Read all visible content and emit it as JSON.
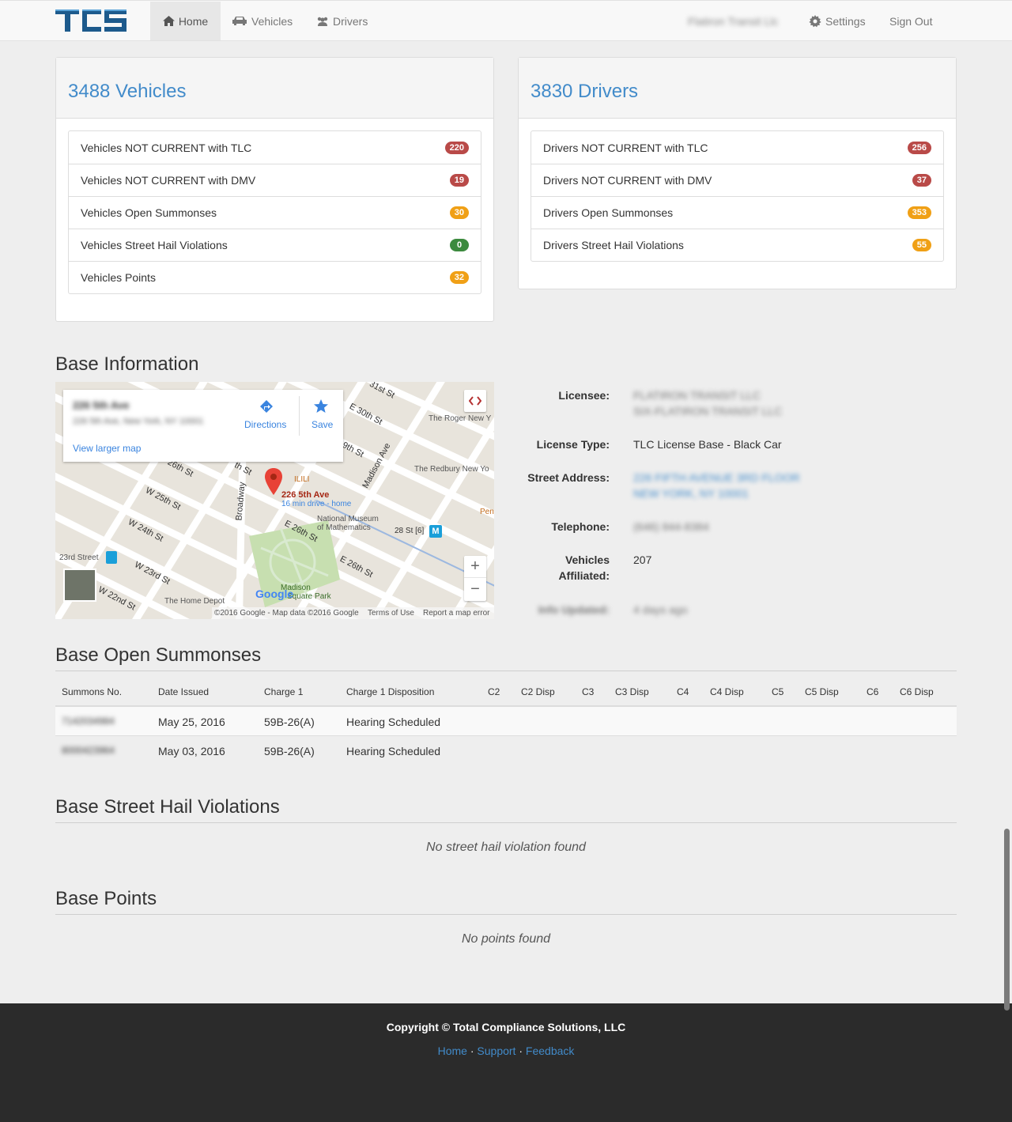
{
  "nav": {
    "logo_text": "TCS",
    "home": "Home",
    "vehicles": "Vehicles",
    "drivers": "Drivers",
    "user": "Flatiron Transit Llc",
    "settings": "Settings",
    "sign_out": "Sign Out"
  },
  "vehicles_panel": {
    "title": "3488 Vehicles",
    "items": [
      {
        "label": "Vehicles NOT CURRENT with TLC",
        "count": "220",
        "color": "#b94a48"
      },
      {
        "label": "Vehicles NOT CURRENT with DMV",
        "count": "19",
        "color": "#b94a48"
      },
      {
        "label": "Vehicles Open Summonses",
        "count": "30",
        "color": "#f0a016"
      },
      {
        "label": "Vehicles Street Hail Violations",
        "count": "0",
        "color": "#3c8a3e"
      },
      {
        "label": "Vehicles Points",
        "count": "32",
        "color": "#f0a016"
      }
    ]
  },
  "drivers_panel": {
    "title": "3830 Drivers",
    "items": [
      {
        "label": "Drivers NOT CURRENT with TLC",
        "count": "256",
        "color": "#b94a48"
      },
      {
        "label": "Drivers NOT CURRENT with DMV",
        "count": "37",
        "color": "#b94a48"
      },
      {
        "label": "Drivers Open Summonses",
        "count": "353",
        "color": "#f0a016"
      },
      {
        "label": "Drivers Street Hail Violations",
        "count": "55",
        "color": "#f0a016"
      }
    ]
  },
  "base_info": {
    "heading": "Base Information",
    "map": {
      "card_title": "226 5th Ave",
      "card_address": "226 5th Ave, New York, NY 10001",
      "directions": "Directions",
      "save": "Save",
      "view_larger": "View larger map",
      "pin_label": "226 5th Ave",
      "pin_sub": "16 min drive - home",
      "streets": {
        "w26": "W 26th St",
        "w25": "W 25th St",
        "w24": "W 24th St",
        "w23": "W 23rd St",
        "w22": "W 22nd St",
        "e30": "E 30th St",
        "e29": "9th St",
        "e26a": "E 26th St",
        "e26b": "E 26th St",
        "e31": "31st St",
        "broadway": "Broadway",
        "madison": "Madison Ave",
        "fifth": "th St"
      },
      "places": {
        "roger": "The Roger New Y",
        "redbury": "The Redbury New Yo",
        "ilili": "ILILI",
        "museum1": "National Museum",
        "museum2": "of Mathematics",
        "station28": "28 St [6]",
        "station23": "23rd Street",
        "homedepot": "The Home Depot",
        "madison_park1": "Madison",
        "madison_park2": "Square Park",
        "pen": "Pen"
      },
      "attribution": "©2016 Google - Map data ©2016 Google",
      "terms": "Terms of Use",
      "report": "Report a map error",
      "google": "Google"
    },
    "licensee_label": "Licensee:",
    "licensee_1": "FLATIRON TRANSIT LLC",
    "licensee_2": "SIX-FLATIRON TRANSIT LLC",
    "license_type_label": "License Type:",
    "license_type": "TLC License Base - Black Car",
    "street_label": "Street Address:",
    "street_1": "226 FIFTH AVENUE 3RD FLOOR",
    "street_2": "NEW YORK, NY 10001",
    "telephone_label": "Telephone:",
    "telephone": "(646) 844-8384",
    "vehicles_label_1": "Vehicles",
    "vehicles_label_2": "Affiliated:",
    "vehicles_affiliated": "207",
    "updated_label": "Info Updated:",
    "updated": "4 days ago"
  },
  "summonses": {
    "heading": "Base Open Summonses",
    "columns": [
      "Summons No.",
      "Date Issued",
      "Charge 1",
      "Charge 1 Disposition",
      "C2",
      "C2 Disp",
      "C3",
      "C3 Disp",
      "C4",
      "C4 Disp",
      "C5",
      "C5 Disp",
      "C6",
      "C6 Disp"
    ],
    "rows": [
      {
        "no": "7142034984",
        "date": "May 25, 2016",
        "charge": "59B-26(A)",
        "disposition": "Hearing Scheduled"
      },
      {
        "no": "8000423964",
        "date": "May 03, 2016",
        "charge": "59B-26(A)",
        "disposition": "Hearing Scheduled"
      }
    ]
  },
  "street_hail": {
    "heading": "Base Street Hail Violations",
    "empty": "No street hail violation found"
  },
  "points": {
    "heading": "Base Points",
    "empty": "No points found"
  },
  "footer": {
    "copyright": "Copyright © Total Compliance Solutions, LLC",
    "links": [
      "Home",
      "Support",
      "Feedback"
    ],
    "separator": "·"
  }
}
